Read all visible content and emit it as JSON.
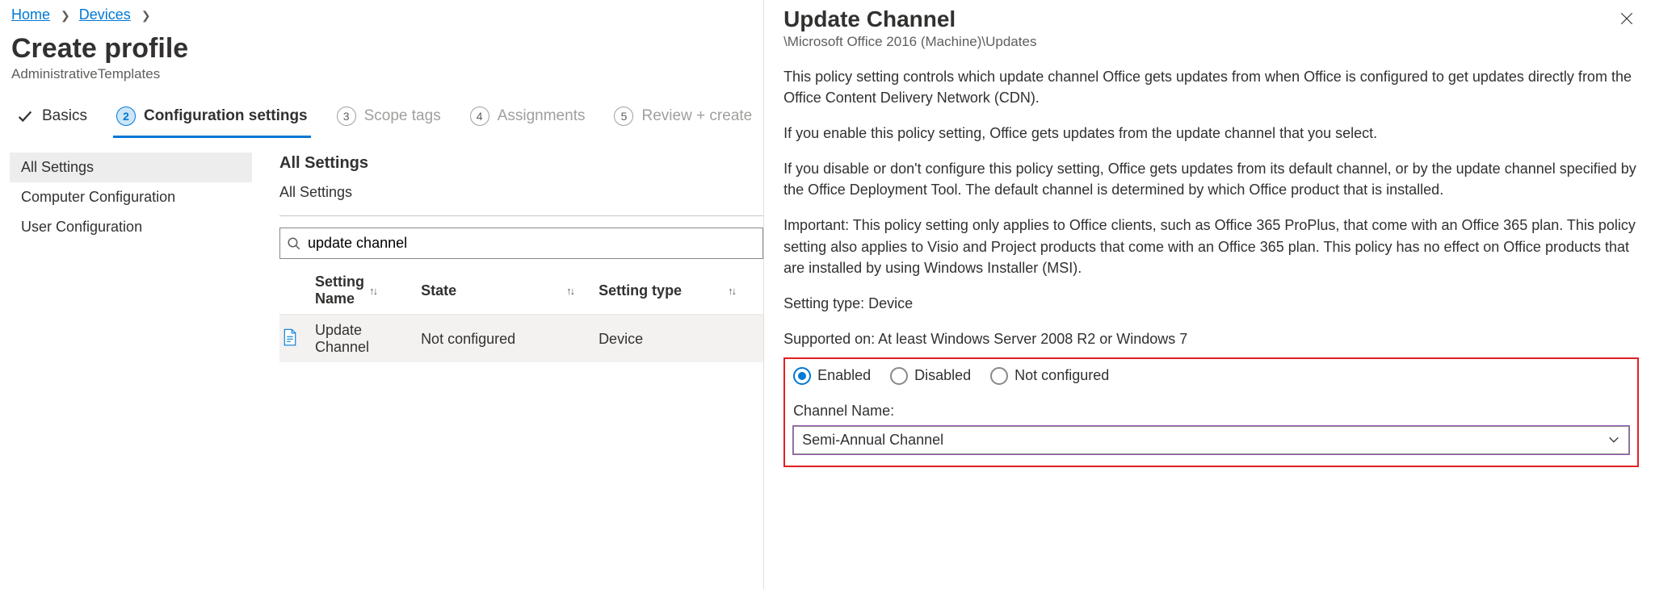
{
  "breadcrumb": {
    "home": "Home",
    "devices": "Devices"
  },
  "page": {
    "title": "Create profile",
    "subtitle": "AdministrativeTemplates"
  },
  "steps": {
    "basics": "Basics",
    "config_num": "2",
    "config": "Configuration settings",
    "scope_num": "3",
    "scope": "Scope tags",
    "assign_num": "4",
    "assign": "Assignments",
    "review_num": "5",
    "review": "Review + create"
  },
  "sidebar": {
    "all": "All Settings",
    "computer": "Computer Configuration",
    "user": "User Configuration"
  },
  "settings": {
    "heading": "All Settings",
    "sub": "All Settings",
    "search_value": "update channel",
    "col_name": "Setting Name",
    "col_state": "State",
    "col_type": "Setting type",
    "row1": {
      "name": "Update Channel",
      "state": "Not configured",
      "type": "Device"
    }
  },
  "panel": {
    "title": "Update Channel",
    "subtitle": "\\Microsoft Office 2016 (Machine)\\Updates",
    "p1": "This policy setting controls which update channel Office gets updates from when Office is configured to get updates directly from the Office Content Delivery Network (CDN).",
    "p2": "If you enable this policy setting, Office gets updates from the update channel that you select.",
    "p3": "If you disable or don't configure this policy setting, Office gets updates from its default channel, or by the update channel specified by the Office Deployment Tool. The default channel is determined by which Office product that is installed.",
    "p4": "Important: This policy setting only applies to Office clients, such as Office 365 ProPlus, that come with an Office 365 plan. This policy setting also applies to Visio and Project products that come with an Office 365 plan. This policy has no effect on Office products that are installed by using Windows Installer (MSI).",
    "setting_type": "Setting type: Device",
    "supported": "Supported on: At least Windows Server 2008 R2 or Windows 7",
    "radio_enabled": "Enabled",
    "radio_disabled": "Disabled",
    "radio_notconf": "Not configured",
    "channel_label": "Channel Name:",
    "channel_value": "Semi-Annual Channel"
  }
}
